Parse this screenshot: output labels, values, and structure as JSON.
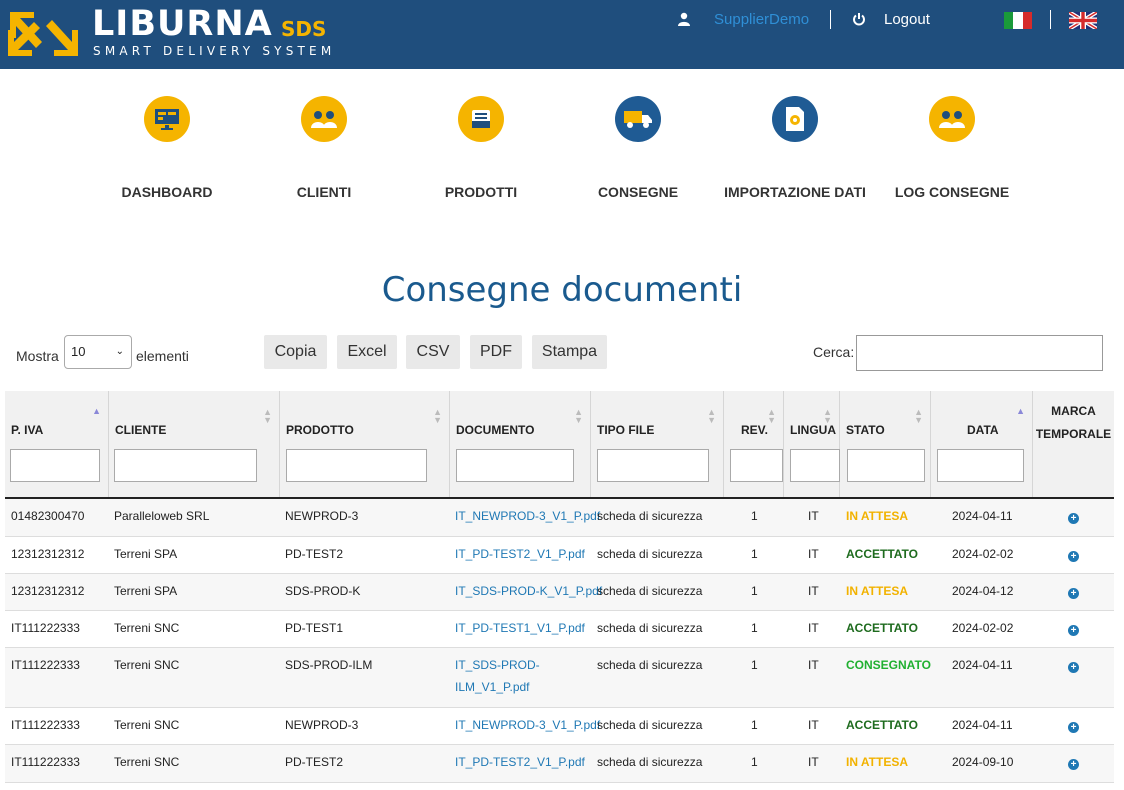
{
  "header": {
    "logo_title": "LIBURNA",
    "logo_sds": "SDS",
    "logo_subtitle": "SMART DELIVERY SYSTEM",
    "user_icon": "user-icon",
    "username": "SupplierDemo",
    "logout_icon": "power-icon",
    "logout_label": "Logout",
    "languages": [
      "it-flag-icon",
      "uk-flag-icon"
    ]
  },
  "nav": {
    "items": [
      {
        "label": "DASHBOARD",
        "icon": "monitor-icon",
        "color": "#f5b400"
      },
      {
        "label": "CLIENTI",
        "icon": "users-icon",
        "color": "#f5b400"
      },
      {
        "label": "PRODOTTI",
        "icon": "box-icon",
        "color": "#f5b400"
      },
      {
        "label": "CONSEGNE",
        "icon": "truck-icon",
        "color": "#1f5b94"
      },
      {
        "label": "IMPORTAZIONE DATI",
        "icon": "file-gear-icon",
        "color": "#1f5b94"
      },
      {
        "label": "LOG CONSEGNE",
        "icon": "users-icon",
        "color": "#f5b400"
      }
    ]
  },
  "page": {
    "title": "Consegne documenti"
  },
  "controls": {
    "show_label": "Mostra",
    "length_value": "10",
    "entries_label": "elementi",
    "buttons": [
      "Copia",
      "Excel",
      "CSV",
      "PDF",
      "Stampa"
    ],
    "search_label": "Cerca:",
    "search_value": ""
  },
  "table": {
    "columns": [
      "P. IVA",
      "CLIENTE",
      "PRODOTTO",
      "DOCUMENTO",
      "TIPO FILE",
      "REV.",
      "LINGUA",
      "STATO",
      "DATA",
      "MARCA TEMPORALE"
    ],
    "rows": [
      {
        "piva": "01482300470",
        "cliente": "Paralleloweb SRL",
        "prodotto": "NEWPROD-3",
        "documento": "IT_NEWPROD-3_V1_P.pdf",
        "tipo": "scheda di sicurezza",
        "rev": "1",
        "lingua": "IT",
        "stato": "IN ATTESA",
        "data": "2024-04-11"
      },
      {
        "piva": "12312312312",
        "cliente": "Terreni SPA",
        "prodotto": "PD-TEST2",
        "documento": "IT_PD-TEST2_V1_P.pdf",
        "tipo": "scheda di sicurezza",
        "rev": "1",
        "lingua": "IT",
        "stato": "ACCETTATO",
        "data": "2024-02-02"
      },
      {
        "piva": "12312312312",
        "cliente": "Terreni SPA",
        "prodotto": "SDS-PROD-K",
        "documento": "IT_SDS-PROD-K_V1_P.pdf",
        "tipo": "scheda di sicurezza",
        "rev": "1",
        "lingua": "IT",
        "stato": "IN ATTESA",
        "data": "2024-04-12"
      },
      {
        "piva": "IT111222333",
        "cliente": "Terreni SNC",
        "prodotto": "PD-TEST1",
        "documento": "IT_PD-TEST1_V1_P.pdf",
        "tipo": "scheda di sicurezza",
        "rev": "1",
        "lingua": "IT",
        "stato": "ACCETTATO",
        "data": "2024-02-02"
      },
      {
        "piva": "IT111222333",
        "cliente": "Terreni SNC",
        "prodotto": "SDS-PROD-ILM",
        "documento": "IT_SDS-PROD-ILM_V1_P.pdf",
        "documento_l1": "IT_SDS-PROD-",
        "documento_l2": "ILM_V1_P.pdf",
        "tipo": "scheda di sicurezza",
        "rev": "1",
        "lingua": "IT",
        "stato": "CONSEGNATO",
        "data": "2024-04-11"
      },
      {
        "piva": "IT111222333",
        "cliente": "Terreni SNC",
        "prodotto": "NEWPROD-3",
        "documento": "IT_NEWPROD-3_V1_P.pdf",
        "tipo": "scheda di sicurezza",
        "rev": "1",
        "lingua": "IT",
        "stato": "ACCETTATO",
        "data": "2024-04-11"
      },
      {
        "piva": "IT111222333",
        "cliente": "Terreni SNC",
        "prodotto": "PD-TEST2",
        "documento": "IT_PD-TEST2_V1_P.pdf",
        "tipo": "scheda di sicurezza",
        "rev": "1",
        "lingua": "IT",
        "stato": "IN ATTESA",
        "data": "2024-09-10"
      }
    ]
  },
  "colors": {
    "header_bg": "#1f4e7d",
    "accent_yellow": "#f5b400",
    "title_blue": "#1a5a8e",
    "link_blue": "#1f78b4",
    "status_in_attesa": "#f2b200",
    "status_accettato": "#1e6b1e",
    "status_consegnato": "#20b030"
  }
}
